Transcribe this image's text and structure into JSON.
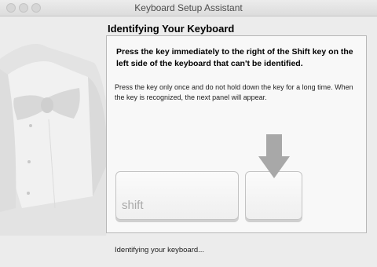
{
  "window": {
    "title": "Keyboard Setup Assistant"
  },
  "main": {
    "heading": "Identifying Your Keyboard",
    "instruction": "Press the key immediately to the right of the Shift key on the left side of the keyboard that can't be identified.",
    "detail": "Press the key only once and do not hold down the key for a long time. When the key is recognized, the next panel will appear.",
    "keys": {
      "shift_label": "shift",
      "target_label": ""
    }
  },
  "status": {
    "text": "Identifying your keyboard..."
  },
  "icons": {
    "illustration": "tuxedo-illustration",
    "arrow": "arrow-down-icon"
  }
}
